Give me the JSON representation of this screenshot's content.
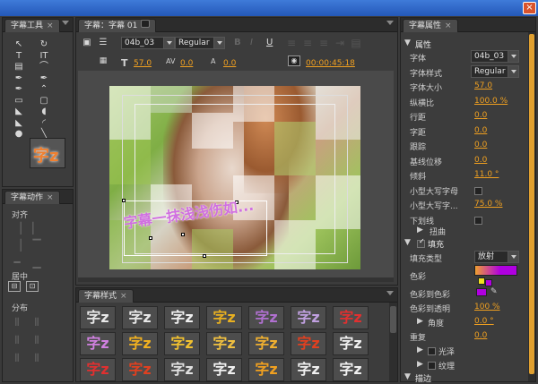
{
  "window": {
    "close_glyph": "×"
  },
  "tools_panel": {
    "tab_label": "字幕工具",
    "close_glyph": "×",
    "preview_glyph": "字z",
    "tools": [
      "selection-tool-icon",
      "rotate-tool-icon",
      "type-tool-icon",
      "vertical-type-tool-icon",
      "area-type-tool-icon",
      "path-type-tool-icon",
      "pen-tool-icon",
      "delete-anchor-tool-icon",
      "add-anchor-tool-icon",
      "convert-anchor-tool-icon",
      "rectangle-tool-icon",
      "rounded-rectangle-tool-icon",
      "clipped-corner-tool-icon",
      "rounded-corner-tool-icon",
      "wedge-tool-icon",
      "arc-tool-icon",
      "ellipse-tool-icon",
      "line-tool-icon"
    ]
  },
  "actions_panel": {
    "tab_label": "字幕动作",
    "close_glyph": "×",
    "align_label": "对齐",
    "center_label": "居中",
    "distribute_label": "分布"
  },
  "title_panel": {
    "tab_label": "字幕：字幕 01",
    "font_value": "04b_03",
    "style_value": "Regular",
    "bold_glyph": "B",
    "italic_glyph": "I",
    "underline_glyph": "U",
    "size_icon": "T",
    "size_value": "57.0",
    "kerning_value": "0.0",
    "leading_value": "0.0",
    "timecode": "00:00:45:18",
    "path_text": "字幕一抹浅浅伤如..."
  },
  "styles_panel": {
    "tab_label": "字幕样式",
    "close_glyph": "×",
    "sample_glyph": "字z",
    "colors": [
      "#e8e8e8",
      "#e8e8e8",
      "#f0f0f0",
      "#e8b020",
      "#b070d0",
      "#c0a0e0",
      "#e03030",
      "#d080e0",
      "#f0b020",
      "#f0c030",
      "#f0c040",
      "#f0b030",
      "#e04020",
      "#f0f0f0",
      "#e03030",
      "#e04020",
      "#e0e0e0",
      "#f0f0f0",
      "#f0a020",
      "#f0f0f0",
      "#f0f0f0"
    ]
  },
  "props_panel": {
    "tab_label": "字幕属性",
    "close_glyph": "×",
    "section_props": "属性",
    "rows": [
      {
        "label": "字体",
        "value": "04b_03"
      },
      {
        "label": "字体样式",
        "value": "Regular"
      },
      {
        "label": "字体大小",
        "value": "57.0"
      },
      {
        "label": "纵横比",
        "value": "100.0 %"
      },
      {
        "label": "行距",
        "value": "0.0"
      },
      {
        "label": "字距",
        "value": "0.0"
      },
      {
        "label": "跟踪",
        "value": "0.0"
      },
      {
        "label": "基线位移",
        "value": "0.0"
      },
      {
        "label": "倾斜",
        "value": "11.0 °"
      },
      {
        "label": "小型大写字母",
        "value": ""
      },
      {
        "label": "小型大写字...",
        "value": "75.0 %"
      },
      {
        "label": "下划线",
        "value": ""
      }
    ],
    "distort_label": "扭曲",
    "fill_section": "填充",
    "fill_type_label": "填充类型",
    "fill_type_value": "放射",
    "color_label": "色彩",
    "color_to_color_label": "色彩到色彩",
    "color_to_opacity_label": "色彩到透明",
    "color_to_opacity_value": "100 %",
    "angle_label": "角度",
    "angle_value": "0.0 °",
    "repeat_label": "重复",
    "repeat_value": "0.0",
    "sheen_label": "光泽",
    "texture_label": "纹理",
    "stroke_section": "描边",
    "gradient_start": "#f0a030",
    "gradient_end": "#b000e0"
  }
}
